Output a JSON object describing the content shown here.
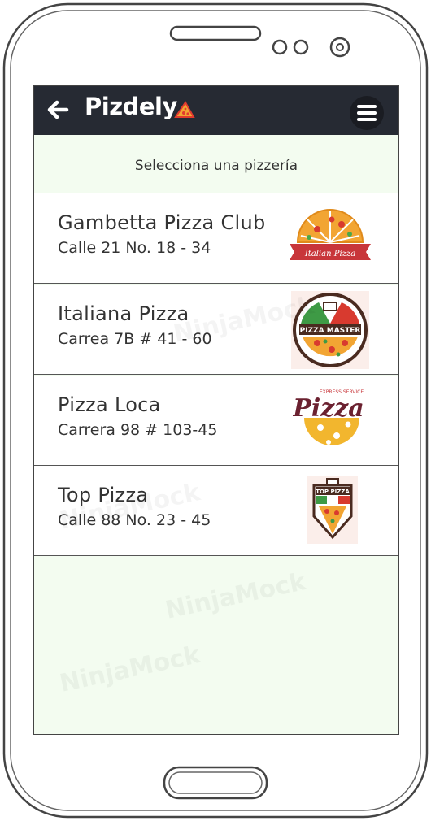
{
  "app": {
    "title": "Pizdely"
  },
  "subheader": {
    "text": "Selecciona una pizzería"
  },
  "pizzerias": [
    {
      "name": "Gambetta Pizza Club",
      "address": "Calle 21 No. 18 - 34",
      "logo": "italian-pizza-logo",
      "logo_text": "Italian Pizza"
    },
    {
      "name": "Italiana Pizza",
      "address": "Carrea 7B # 41 - 60",
      "logo": "pizza-master-logo",
      "logo_text": "PIZZA MASTER"
    },
    {
      "name": "Pizza Loca",
      "address": "Carrera 98 # 103-45",
      "logo": "express-pizza-logo",
      "logo_text": "Pizza",
      "logo_subtext": "EXPRESS SERVICE"
    },
    {
      "name": "Top Pizza",
      "address": "Calle 88 No. 23 - 45",
      "logo": "top-pizza-logo",
      "logo_text": "TOP PIZZA"
    }
  ],
  "watermark": "NinjaMock",
  "icons": {
    "back": "arrow-left-icon",
    "menu": "hamburger-menu-icon",
    "brand": "pizza-slice-icon"
  },
  "colors": {
    "appbar": "#262a33",
    "screen_bg": "#f3fcf0",
    "pizza_orange": "#f2a533",
    "ribbon_red": "#c8363a"
  }
}
